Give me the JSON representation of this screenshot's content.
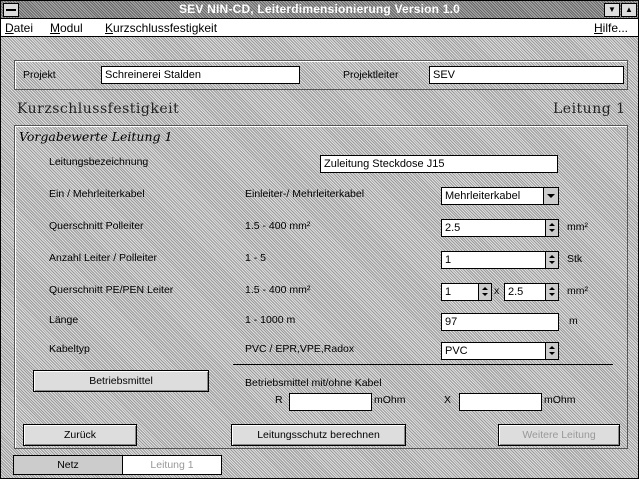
{
  "window": {
    "title": "SEV NIN-CD, Leiterdimensionierung Version 1.0"
  },
  "menu": {
    "datei": "atei",
    "datei_u": "D",
    "modul": "odul",
    "modul_u": "M",
    "kurz": "urzschlussfestigkeit",
    "kurz_u": "K",
    "hilfe": "ilfe...",
    "hilfe_u": "H"
  },
  "project": {
    "projekt_label": "Projekt",
    "projekt_value": "Schreinerei Stalden",
    "leiter_label": "Projektleiter",
    "leiter_value": "SEV"
  },
  "header": {
    "title": "Kurzschlussfestigkeit",
    "right": "Leitung 1"
  },
  "vorgabe": {
    "title": "Vorgabewerte  Leitung 1",
    "rows": [
      {
        "label": "Leitungsbezeichnung",
        "range": "",
        "value": "Zuleitung Steckdose J15",
        "unit": ""
      },
      {
        "label": "Ein / Mehrleiterkabel",
        "range": "Einleiter-/ Mehrleiterkabel",
        "value": "Mehrleiterkabel",
        "unit": ""
      },
      {
        "label": "Querschnitt Polleiter",
        "range": "1.5 - 400 mm²",
        "value": "2.5",
        "unit": "mm²"
      },
      {
        "label": "Anzahl Leiter / Polleiter",
        "range": "1 - 5",
        "value": "1",
        "unit": "Stk"
      },
      {
        "label": "Querschnitt PE/PEN Leiter",
        "range": "1.5 - 400 mm²",
        "value": "1",
        "x": "x",
        "value2": "2.5",
        "unit": "mm²"
      },
      {
        "label": "Länge",
        "range": "1 - 1000 m",
        "value": "97",
        "unit": "m"
      },
      {
        "label": "Kabeltyp",
        "range": "PVC / EPR,VPE,Radox",
        "value": "PVC",
        "unit": ""
      }
    ]
  },
  "betrieb": {
    "button": "Betriebsmittel",
    "desc": "Betriebsmittel mit/ohne Kabel",
    "r_label": "R",
    "r_value": "",
    "r_unit": "mOhm",
    "x_label": "X",
    "x_value": "",
    "x_unit": "mOhm"
  },
  "actions": {
    "back": "Zurück",
    "calc": "Leitungsschutz berechnen",
    "next": "Weitere Leitung"
  },
  "tabs": {
    "netz": "Netz",
    "leitung": "Leitung 1"
  }
}
